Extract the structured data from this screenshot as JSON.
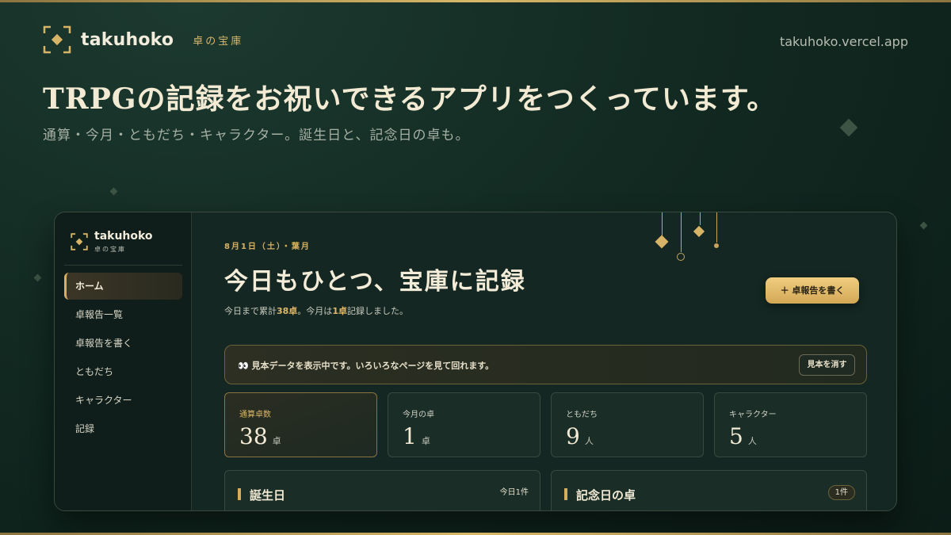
{
  "header": {
    "brand_name": "takuhoko",
    "brand_sub": "卓の宝庫",
    "url": "takuhoko.vercel.app",
    "headline": "TRPGの記録をお祝いできるアプリをつくっています。",
    "subline": "通算・今月・ともだち・キャラクター。誕生日と、記念日の卓も。"
  },
  "sidebar": {
    "brand_name": "takuhoko",
    "brand_sub": "卓の宝庫",
    "items": [
      {
        "label": "ホーム",
        "active": true
      },
      {
        "label": "卓報告一覧"
      },
      {
        "label": "卓報告を書く"
      },
      {
        "label": "ともだち"
      },
      {
        "label": "キャラクター"
      },
      {
        "label": "記録"
      }
    ]
  },
  "main": {
    "date_line": "8月1日（土）・葉月",
    "title": "今日もひとつ、宝庫に記録",
    "sub_prefix": "今日まで累計",
    "sub_total": "38卓",
    "sub_middle": "。今月は",
    "sub_month": "1卓",
    "sub_suffix": "記録しました。",
    "write_button": "＋ 卓報告を書く",
    "notice": {
      "icon": "👀",
      "text": "見本データを表示中です。いろいろなページを見て回れます。",
      "button": "見本を消す"
    },
    "stats": [
      {
        "label": "通算卓数",
        "value": "38",
        "unit": "卓"
      },
      {
        "label": "今月の卓",
        "value": "1",
        "unit": "卓"
      },
      {
        "label": "ともだち",
        "value": "9",
        "unit": "人"
      },
      {
        "label": "キャラクター",
        "value": "5",
        "unit": "人"
      }
    ],
    "panels": [
      {
        "title": "誕生日",
        "count": "今日1件"
      },
      {
        "title": "記念日の卓",
        "count": "1件"
      }
    ]
  },
  "colors": {
    "accent": "#d8b466",
    "background": "#122a22"
  }
}
